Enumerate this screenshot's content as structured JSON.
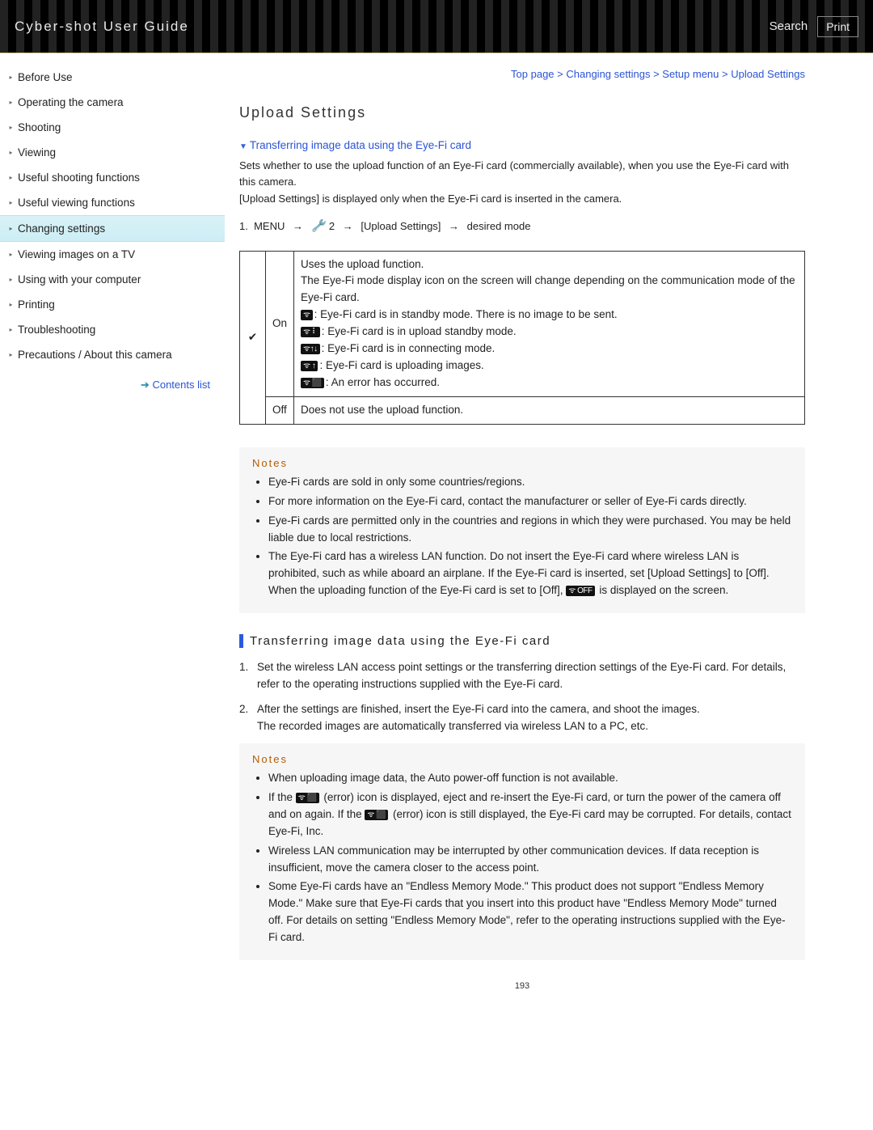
{
  "header": {
    "title": "Cyber-shot User Guide",
    "search": "Search",
    "print": "Print"
  },
  "sidebar": {
    "items": [
      "Before Use",
      "Operating the camera",
      "Shooting",
      "Viewing",
      "Useful shooting functions",
      "Useful viewing functions",
      "Changing settings",
      "Viewing images on a TV",
      "Using with your computer",
      "Printing",
      "Troubleshooting",
      "Precautions / About this camera"
    ],
    "active_index": 6,
    "contents_link": "Contents list"
  },
  "breadcrumb": {
    "top": "Top page",
    "a": "Changing settings",
    "b": "Setup menu",
    "c": "Upload Settings",
    "sep": " > "
  },
  "page": {
    "title": "Upload Settings",
    "anchor": "Transferring image data using the Eye-Fi card",
    "intro1": "Sets whether to use the upload function of an Eye-Fi card (commercially available), when you use the Eye-Fi card with this camera.",
    "intro2": "[Upload Settings] is displayed only when the Eye-Fi card is inserted in the camera.",
    "path": {
      "num": "1.",
      "menu": "MENU",
      "n2": "2",
      "seg": "[Upload Settings]",
      "last": "desired mode"
    },
    "table": {
      "on_label": "On",
      "on_line1": "Uses the upload function.",
      "on_line2": "The Eye-Fi mode display icon on the screen will change depending on the communication mode of the Eye-Fi card.",
      "on_standby": ": Eye-Fi card is in standby mode. There is no image to be sent.",
      "on_upload_standby": ": Eye-Fi card is in upload standby mode.",
      "on_connecting": ": Eye-Fi card is in connecting mode.",
      "on_uploading": ": Eye-Fi card is uploading images.",
      "on_error": ": An error has occurred.",
      "off_label": "Off",
      "off_text": "Does not use the upload function."
    },
    "notes1_title": "Notes",
    "notes1": [
      "Eye-Fi cards are sold in only some countries/regions.",
      "For more information on the Eye-Fi card, contact the manufacturer or seller of Eye-Fi cards directly.",
      "Eye-Fi cards are permitted only in the countries and regions in which they were purchased. You may be held liable due to local restrictions."
    ],
    "notes1_last_a": "The Eye-Fi card has a wireless LAN function. Do not insert the Eye-Fi card where wireless LAN is prohibited, such as while aboard an airplane. If the Eye-Fi card is inserted, set [Upload Settings] to [Off]. When the uploading function of the Eye-Fi card is set to [Off], ",
    "notes1_last_b": " is displayed on the screen.",
    "section2": "Transferring image data using the Eye-Fi card",
    "steps": [
      "Set the wireless LAN access point settings or the transferring direction settings of the Eye-Fi card. For details, refer to the operating instructions supplied with the Eye-Fi card.",
      "After the settings are finished, insert the Eye-Fi card into the camera, and shoot the images.\nThe recorded images are automatically transferred via wireless LAN to a PC, etc."
    ],
    "notes2_title": "Notes",
    "notes2_first": "When uploading image data, the Auto power-off function is not available.",
    "notes2_err_a": "If the ",
    "notes2_err_b": " (error) icon is displayed, eject and re-insert the Eye-Fi card, or turn the power of the camera off and on again. If the ",
    "notes2_err_c": " (error) icon is still displayed, the Eye-Fi card may be corrupted. For details, contact Eye-Fi, Inc.",
    "notes2_rest": [
      "Wireless LAN communication may be interrupted by other communication devices. If data reception is insufficient, move the camera closer to the access point.",
      "Some Eye-Fi cards have an \"Endless Memory Mode.\" This product does not support \"Endless Memory Mode.\" Make sure that Eye-Fi cards that you insert into this product have \"Endless Memory Mode\" turned off. For details on setting \"Endless Memory Mode\", refer to the operating instructions supplied with the Eye-Fi card."
    ],
    "page_number": "193"
  },
  "icons": {
    "off_label": "OFF"
  }
}
